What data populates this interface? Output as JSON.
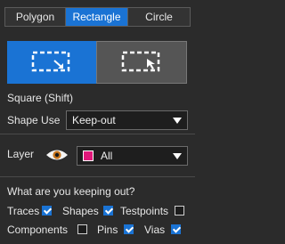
{
  "tabs": [
    {
      "label": "Polygon",
      "active": false
    },
    {
      "label": "Rectangle",
      "active": true
    },
    {
      "label": "Circle",
      "active": false
    }
  ],
  "modes": {
    "selected": "draw-rectangle",
    "items": [
      {
        "name": "rect-draw-mode-icon",
        "active": true
      },
      {
        "name": "rect-select-mode-icon",
        "active": false
      }
    ]
  },
  "square_label": "Square (Shift)",
  "shape_use": {
    "label": "Shape Use",
    "value": "Keep-out"
  },
  "layer": {
    "label": "Layer",
    "value": "All",
    "swatch_color": "#e0187a",
    "visibility_icon": "eye-icon"
  },
  "keepout": {
    "heading": "What are you keeping out?",
    "items": [
      {
        "label": "Traces",
        "checked": true
      },
      {
        "label": "Shapes",
        "checked": true
      },
      {
        "label": "Testpoints",
        "checked": false
      },
      {
        "label": "Components",
        "checked": false
      },
      {
        "label": "Pins",
        "checked": true
      },
      {
        "label": "Vias",
        "checked": true
      }
    ]
  },
  "colors": {
    "accent": "#1a73d4",
    "background": "#2b2b2b"
  }
}
